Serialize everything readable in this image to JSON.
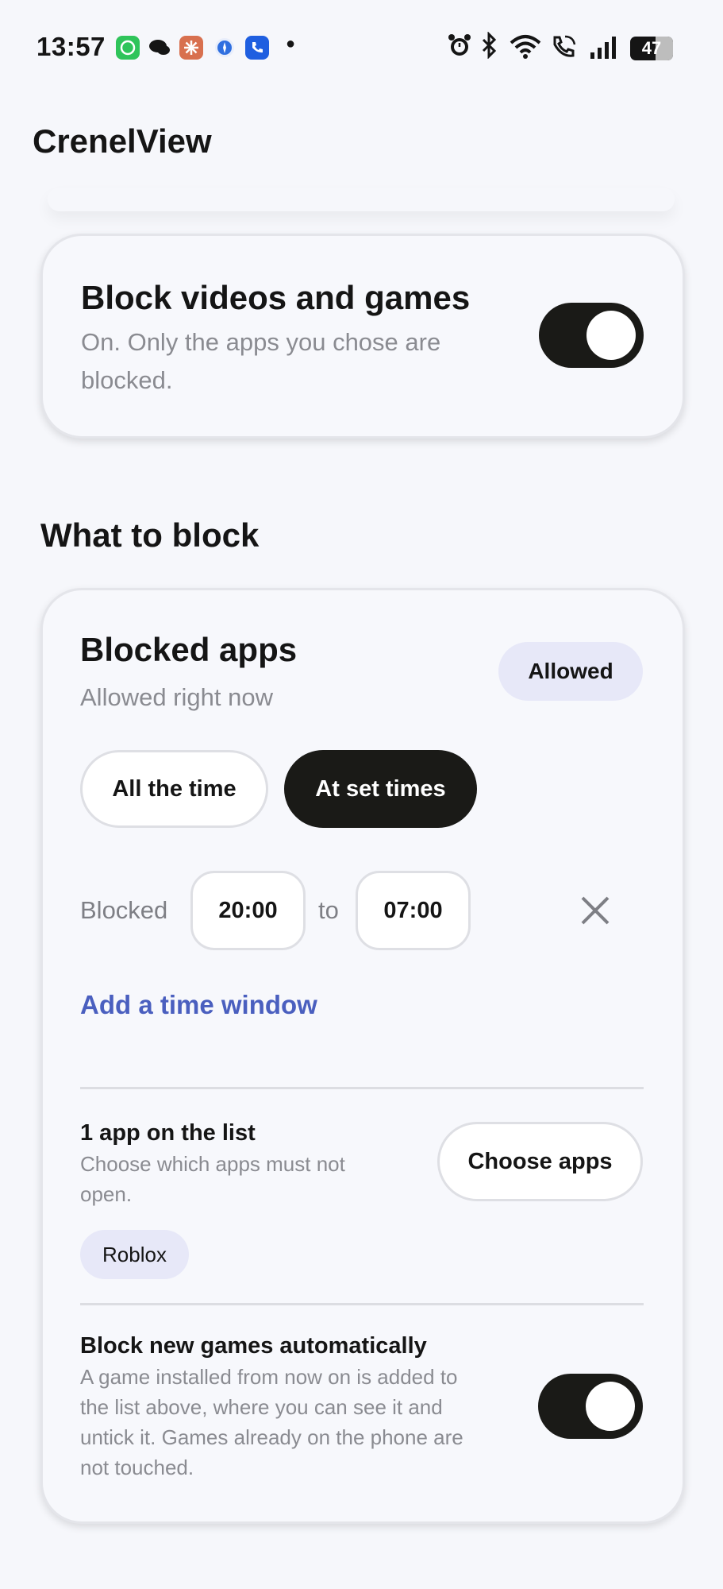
{
  "status_bar": {
    "time": "13:57",
    "battery": "47",
    "notification_icons": [
      "whatsapp-icon",
      "chat-icon",
      "claude-icon",
      "safari-icon",
      "phone-app-icon"
    ],
    "system_icons": [
      "alarm-icon",
      "bluetooth-icon",
      "wifi-icon",
      "wifi-call-icon",
      "signal-icon",
      "battery-icon"
    ]
  },
  "header": {
    "title": "CrenelView"
  },
  "block_card": {
    "title": "Block videos and games",
    "subtitle_line1": "On. Only the apps you chose are",
    "subtitle_line2": "blocked.",
    "toggle_on": true
  },
  "section": {
    "title": "What to block"
  },
  "blocked_apps": {
    "title": "Blocked apps",
    "status": "Allowed right now",
    "badge": "Allowed",
    "modes": [
      "All the time",
      "At set times"
    ],
    "selected_mode": "At set times",
    "window": {
      "label": "Blocked",
      "from": "20:00",
      "to_label": "to",
      "to": "07:00"
    },
    "add_window": "Add a time window",
    "list": {
      "title": "1 app on the list",
      "desc_line1": "Choose which apps must not",
      "desc_line2": "open.",
      "button": "Choose apps",
      "apps": [
        "Roblox"
      ]
    },
    "auto": {
      "title": "Block new games automatically",
      "desc_line1": "A game installed from now on is added to",
      "desc_line2": "the list above, where you can see it and",
      "desc_line3": "untick it. Games already on the phone are",
      "desc_line4": "not touched.",
      "toggle_on": true
    }
  },
  "colors": {
    "accent_link": "#4a5fbf",
    "toggle_on": "#1a1a17",
    "badge_bg": "#e7e8f8",
    "background": "#f6f7fb"
  }
}
